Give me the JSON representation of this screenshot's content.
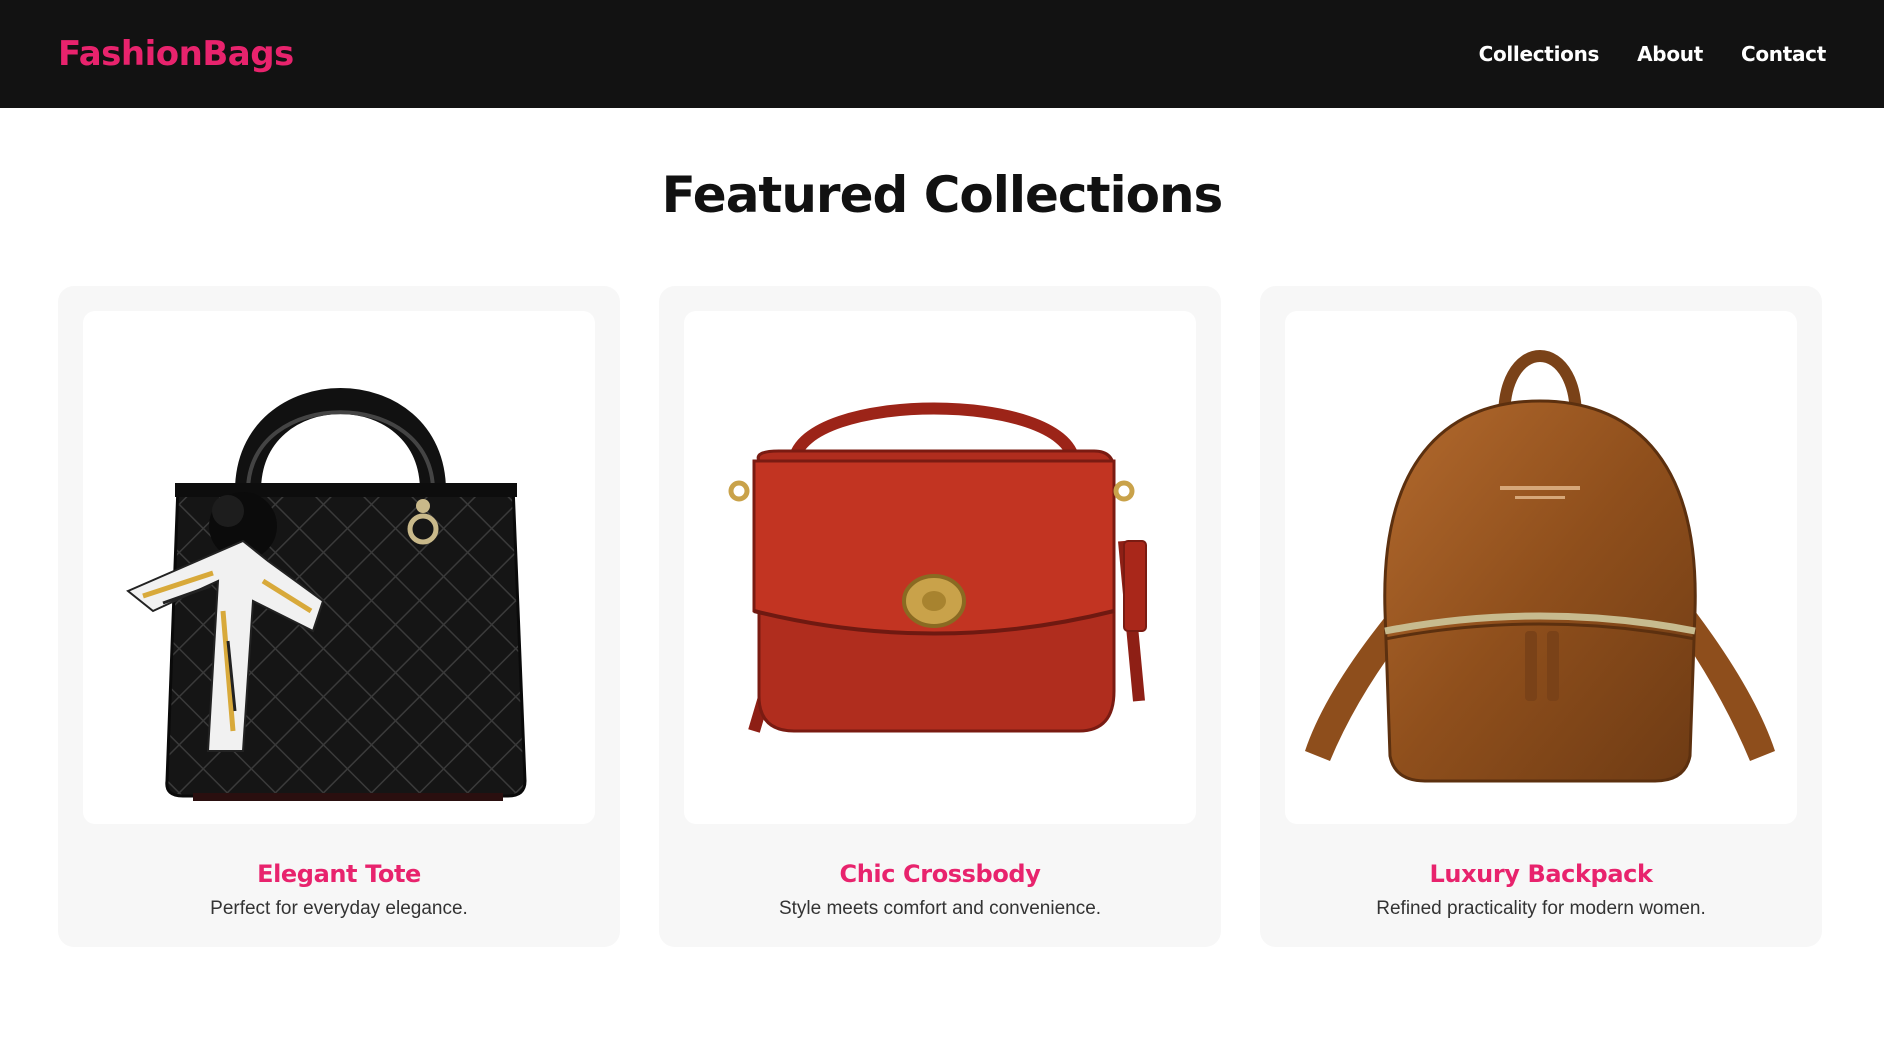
{
  "brand": {
    "name": "FashionBags",
    "color": "#e8236d"
  },
  "nav": {
    "links": [
      "Collections",
      "About",
      "Contact"
    ]
  },
  "page": {
    "title": "Featured Collections"
  },
  "collections": [
    {
      "title": "Elegant Tote",
      "description": "Perfect for everyday elegance.",
      "image": "black-quilted-handbag-image"
    },
    {
      "title": "Chic Crossbody",
      "description": "Style meets comfort and convenience.",
      "image": "red-crossbody-bag-image"
    },
    {
      "title": "Luxury Backpack",
      "description": "Refined practicality for modern women.",
      "image": "brown-leather-backpack-image"
    }
  ],
  "colors": {
    "navbar_bg": "#121212",
    "card_bg": "#f7f7f7",
    "accent": "#e8236d"
  }
}
